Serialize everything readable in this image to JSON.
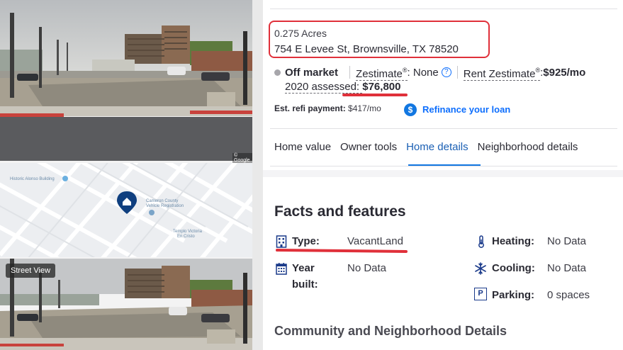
{
  "left": {
    "street_view_label": "Street View",
    "google_credit": "© Google",
    "map": {
      "poi_top": "Historic Alonso Building",
      "poi_right_line1": "Cameron County",
      "poi_right_line2": "Vehicle Registration",
      "poi_bottom_line1": "Templo Victoria",
      "poi_bottom_line2": "En Cristo"
    }
  },
  "listing": {
    "acres": "0.275 Acres",
    "address": "754 E Levee St, Brownsville, TX 78520",
    "status": "Off market",
    "zestimate_label": "Zestimate",
    "zestimate_reg": "®",
    "zestimate_value": ": None",
    "help_icon_glyph": "?",
    "rent_label": "Rent Zestimate",
    "rent_reg": "®",
    "rent_colon": ": ",
    "rent_value": "$925/mo",
    "assessed_label": "2020 assessed: ",
    "assessed_value": "$76,800",
    "refi_label": "Est. refi payment:",
    "refi_value": " $417/mo",
    "refi_icon_glyph": "$",
    "refi_link": "Refinance your loan",
    "annotation_color": "#e0303a"
  },
  "tabs": [
    {
      "label": "Home value"
    },
    {
      "label": "Owner tools"
    },
    {
      "label": "Home details"
    },
    {
      "label": "Neighborhood details"
    }
  ],
  "active_tab": "Home details",
  "facts": {
    "title": "Facts and features",
    "type_label": "Type:",
    "type_value": "VacantLand",
    "year_label_1": "Year",
    "year_label_2": "built:",
    "year_value": "No Data",
    "heating_label": "Heating:",
    "heating_value": "No Data",
    "cooling_label": "Cooling:",
    "cooling_value": "No Data",
    "parking_icon_glyph": "P",
    "parking_label": "Parking:",
    "parking_value": "0 spaces"
  },
  "community_title": "Community and Neighborhood Details",
  "colors": {
    "link_blue": "#0d6efd",
    "tab_active": "#1a5fb4",
    "annotation_red": "#e0303a"
  }
}
